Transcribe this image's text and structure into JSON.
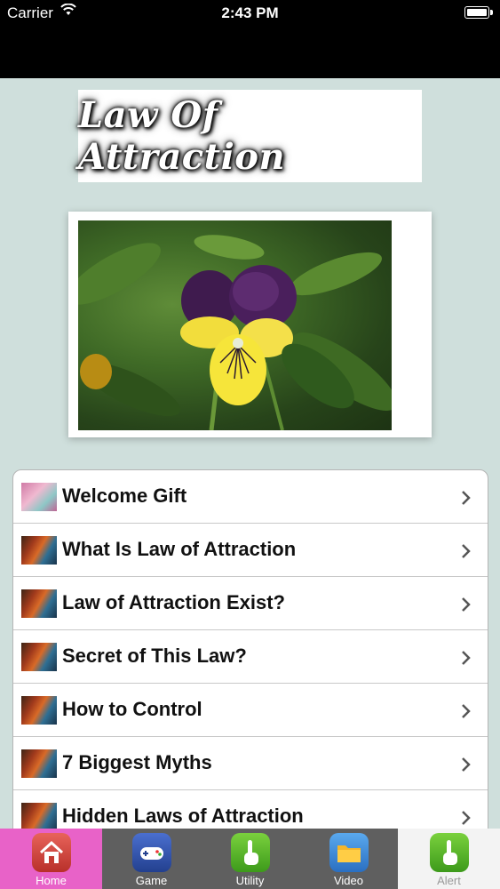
{
  "status_bar": {
    "carrier": "Carrier",
    "time": "2:43 PM"
  },
  "logo": {
    "text": "Law Of Attraction"
  },
  "photo": {
    "subject": "flower-photo"
  },
  "menu": {
    "items": [
      {
        "label": "Welcome Gift",
        "thumb": "gift-thumbnail"
      },
      {
        "label": "What Is Law of Attraction",
        "thumb": "autumn-thumbnail"
      },
      {
        "label": "Law of Attraction Exist?",
        "thumb": "autumn-thumbnail"
      },
      {
        "label": "Secret of This Law?",
        "thumb": "autumn-thumbnail"
      },
      {
        "label": "How to Control",
        "thumb": "autumn-thumbnail"
      },
      {
        "label": "7 Biggest Myths",
        "thumb": "autumn-thumbnail"
      },
      {
        "label": "Hidden Laws of Attraction",
        "thumb": "autumn-thumbnail"
      }
    ]
  },
  "tab_bar": {
    "tabs": [
      {
        "label": "Home",
        "icon": "home-icon",
        "selected": true
      },
      {
        "label": "Game",
        "icon": "gamepad-icon",
        "selected": false
      },
      {
        "label": "Utility",
        "icon": "hand-pointer-icon",
        "selected": false
      },
      {
        "label": "Video",
        "icon": "folder-icon",
        "selected": false
      },
      {
        "label": "Alert",
        "icon": "hand-pointer-icon",
        "selected": false
      }
    ]
  },
  "colors": {
    "background": "#cfdfdc",
    "home_tab_active": "#e862c8",
    "tab_bar": "#5f5f5f"
  }
}
